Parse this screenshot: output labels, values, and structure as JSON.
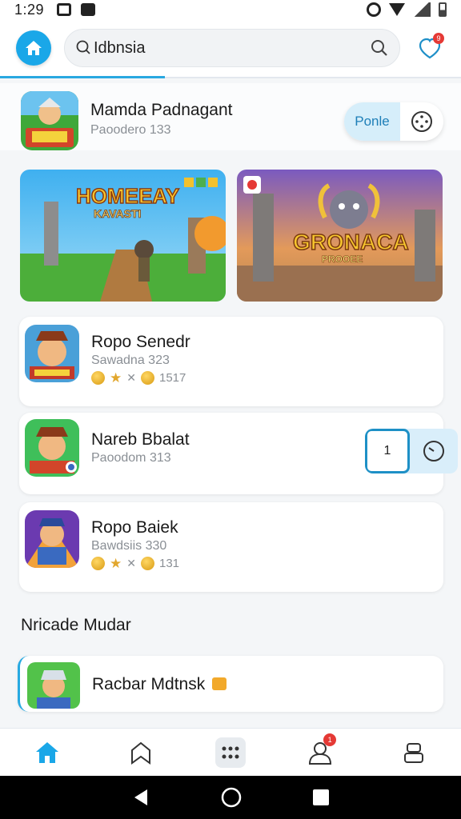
{
  "status_bar": {
    "time": "1:29"
  },
  "search": {
    "text": "Idbnsia"
  },
  "notifications": {
    "count": "9"
  },
  "featured": {
    "title": "Mamda Padnagant",
    "subtitle": "Paoodero 133",
    "action_label": "Ponle"
  },
  "banners": [
    {
      "title": "HOMEEAY",
      "subtitle": "KAVASTI"
    },
    {
      "title": "GRONACA",
      "subtitle": "PROOEE"
    }
  ],
  "apps": [
    {
      "title": "Ropo Senedr",
      "subtitle": "Sawadna 323",
      "rating_text": "1517",
      "has_rating": true
    },
    {
      "title": "Nareb Bbalat",
      "subtitle": "Paoodom 313",
      "action_label": "1",
      "has_rating": false
    },
    {
      "title": "Ropo Baiek",
      "subtitle": "Bawdsiis 330",
      "rating_text": "131",
      "has_rating": true
    }
  ],
  "section": {
    "title": "Nricade Mudar"
  },
  "section_items": [
    {
      "title": "Racbar Mdtnsk"
    }
  ],
  "bottom_nav": {
    "profile_badge": "1"
  },
  "colors": {
    "accent": "#1aa7e8",
    "badge": "#e53935",
    "coin": "#e2a72e"
  }
}
